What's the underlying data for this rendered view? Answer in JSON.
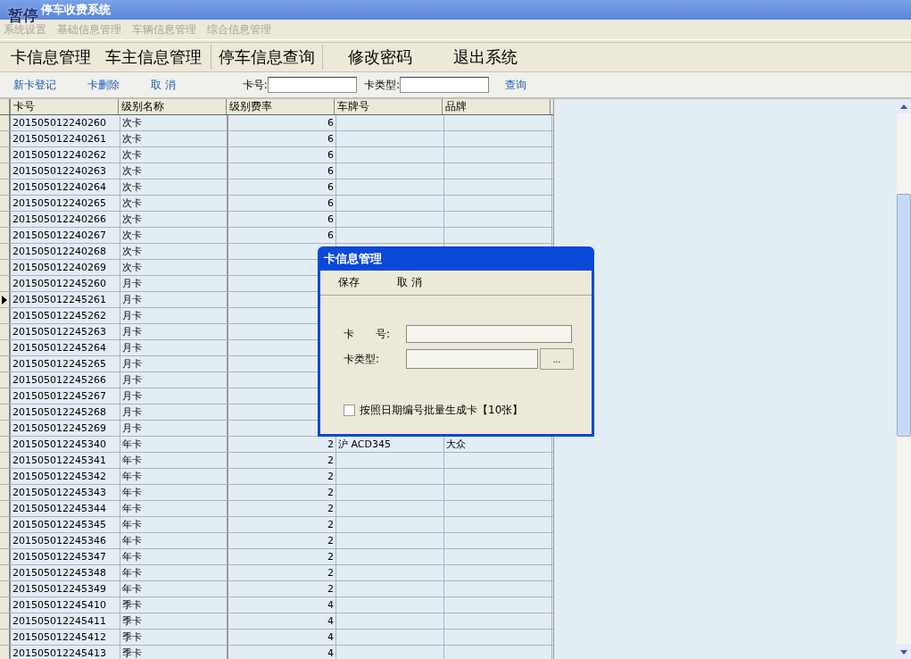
{
  "window": {
    "title": "停车收费系统",
    "logo": "暂停"
  },
  "menu": [
    {
      "label": "系统设置",
      "disabled": true
    },
    {
      "label": "基础信息管理",
      "disabled": true
    },
    {
      "label": "车辆信息管理",
      "disabled": true
    },
    {
      "label": "综合信息管理",
      "disabled": true
    }
  ],
  "main_toolbar": [
    "卡信息管理",
    "车主信息管理",
    "停车信息查询",
    "修改密码",
    "退出系统"
  ],
  "toolbar": {
    "actions": [
      "新卡登记",
      "卡删除",
      "取 消"
    ],
    "card_no_label": "卡号:",
    "card_type_label": "卡类型:",
    "query": "查询"
  },
  "table": {
    "columns": [
      "卡号",
      "级别名称",
      "级别费率",
      "车牌号",
      "品牌"
    ],
    "rows": [
      {
        "card": "201505012240260",
        "level": "次卡",
        "rate": "6",
        "selected": false
      },
      {
        "card": "201505012240261",
        "level": "次卡",
        "rate": "6",
        "selected": false
      },
      {
        "card": "201505012240262",
        "level": "次卡",
        "rate": "6",
        "selected": false
      },
      {
        "card": "201505012240263",
        "level": "次卡",
        "rate": "6",
        "selected": false
      },
      {
        "card": "201505012240264",
        "level": "次卡",
        "rate": "6",
        "selected": false
      },
      {
        "card": "201505012240265",
        "level": "次卡",
        "rate": "6",
        "selected": false
      },
      {
        "card": "201505012240266",
        "level": "次卡",
        "rate": "6",
        "selected": false
      },
      {
        "card": "201505012240267",
        "level": "次卡",
        "rate": "6",
        "selected": false
      },
      {
        "card": "201505012240268",
        "level": "次卡",
        "selected": false
      },
      {
        "card": "201505012240269",
        "level": "次卡",
        "selected": false
      },
      {
        "card": "201505012245260",
        "level": "月卡",
        "selected": false
      },
      {
        "card": "201505012245261",
        "level": "月卡",
        "selected": true
      },
      {
        "card": "201505012245262",
        "level": "月卡",
        "selected": false
      },
      {
        "card": "201505012245263",
        "level": "月卡",
        "selected": false
      },
      {
        "card": "201505012245264",
        "level": "月卡",
        "selected": false
      },
      {
        "card": "201505012245265",
        "level": "月卡",
        "selected": false
      },
      {
        "card": "201505012245266",
        "level": "月卡",
        "selected": false
      },
      {
        "card": "201505012245267",
        "level": "月卡",
        "selected": false
      },
      {
        "card": "201505012245268",
        "level": "月卡",
        "selected": false
      },
      {
        "card": "201505012245269",
        "level": "月卡",
        "selected": false
      },
      {
        "card": "201505012245340",
        "level": "年卡",
        "rate": "2",
        "plate": "沪 ACD345",
        "brand": "大众",
        "selected": false
      },
      {
        "card": "201505012245341",
        "level": "年卡",
        "rate": "2",
        "selected": false
      },
      {
        "card": "201505012245342",
        "level": "年卡",
        "rate": "2",
        "selected": false
      },
      {
        "card": "201505012245343",
        "level": "年卡",
        "rate": "2",
        "selected": false
      },
      {
        "card": "201505012245344",
        "level": "年卡",
        "rate": "2",
        "selected": false
      },
      {
        "card": "201505012245345",
        "level": "年卡",
        "rate": "2",
        "selected": false
      },
      {
        "card": "201505012245346",
        "level": "年卡",
        "rate": "2",
        "selected": false
      },
      {
        "card": "201505012245347",
        "level": "年卡",
        "rate": "2",
        "selected": false
      },
      {
        "card": "201505012245348",
        "level": "年卡",
        "rate": "2",
        "selected": false
      },
      {
        "card": "201505012245349",
        "level": "年卡",
        "rate": "2",
        "selected": false
      },
      {
        "card": "201505012245410",
        "level": "季卡",
        "rate": "4",
        "selected": false
      },
      {
        "card": "201505012245411",
        "level": "季卡",
        "rate": "4",
        "selected": false
      },
      {
        "card": "201505012245412",
        "level": "季卡",
        "rate": "4",
        "selected": false
      },
      {
        "card": "201505012245413",
        "level": "季卡",
        "rate": "4",
        "selected": false
      }
    ]
  },
  "dialog": {
    "title": "卡信息管理",
    "actions": [
      "保存",
      "取 消"
    ],
    "card_no_label": "卡　　号:",
    "card_type_label": "卡类型:",
    "browse": "...",
    "batch": {
      "label": "按照日期编号批量生成卡【10张】",
      "checked": false
    }
  }
}
